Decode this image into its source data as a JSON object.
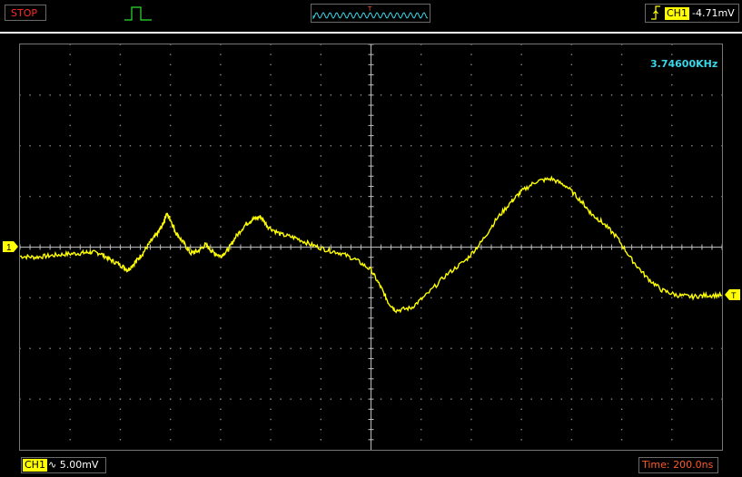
{
  "status": {
    "run_state": "STOP"
  },
  "trigger": {
    "channel": "CH1",
    "level": "-4.71mV",
    "marker": "T"
  },
  "measure": {
    "frequency": "3.74600KHz"
  },
  "channel": {
    "label": "CH1",
    "marker": "1",
    "coupling_symbol": "∿",
    "scale": "5.00mV"
  },
  "timebase": {
    "label": "Time: 200.0ns"
  },
  "colors": {
    "trace": "#ffff00",
    "grid": "#8a8a8a",
    "stop": "#ff2a2a",
    "freq": "#38d6e8",
    "time": "#ff5a2a"
  },
  "trace": {
    "note_units": "divisions; x 0..14 (left to right), y positive up, 0 = CH1 reference line",
    "points": [
      [
        0,
        -0.18
      ],
      [
        0.3,
        -0.2
      ],
      [
        0.6,
        -0.17
      ],
      [
        0.9,
        -0.14
      ],
      [
        1.2,
        -0.12
      ],
      [
        1.4,
        -0.1
      ],
      [
        1.6,
        -0.12
      ],
      [
        1.8,
        -0.25
      ],
      [
        2.0,
        -0.35
      ],
      [
        2.15,
        -0.45
      ],
      [
        2.3,
        -0.3
      ],
      [
        2.45,
        -0.12
      ],
      [
        2.6,
        0.1
      ],
      [
        2.75,
        0.28
      ],
      [
        2.85,
        0.45
      ],
      [
        2.92,
        0.66
      ],
      [
        3.0,
        0.55
      ],
      [
        3.1,
        0.3
      ],
      [
        3.25,
        0.1
      ],
      [
        3.4,
        -0.12
      ],
      [
        3.55,
        -0.08
      ],
      [
        3.7,
        0.05
      ],
      [
        3.85,
        -0.1
      ],
      [
        4.0,
        -0.18
      ],
      [
        4.15,
        -0.05
      ],
      [
        4.3,
        0.2
      ],
      [
        4.5,
        0.45
      ],
      [
        4.65,
        0.55
      ],
      [
        4.8,
        0.6
      ],
      [
        4.95,
        0.4
      ],
      [
        5.2,
        0.25
      ],
      [
        5.5,
        0.18
      ],
      [
        5.8,
        0.05
      ],
      [
        6.1,
        -0.05
      ],
      [
        6.4,
        -0.12
      ],
      [
        6.7,
        -0.25
      ],
      [
        7.0,
        -0.45
      ],
      [
        7.2,
        -0.8
      ],
      [
        7.35,
        -1.1
      ],
      [
        7.5,
        -1.25
      ],
      [
        7.8,
        -1.2
      ],
      [
        8.1,
        -0.95
      ],
      [
        8.5,
        -0.55
      ],
      [
        8.9,
        -0.25
      ],
      [
        9.2,
        0.1
      ],
      [
        9.5,
        0.55
      ],
      [
        9.8,
        0.9
      ],
      [
        10.0,
        1.1
      ],
      [
        10.3,
        1.3
      ],
      [
        10.6,
        1.35
      ],
      [
        10.9,
        1.2
      ],
      [
        11.2,
        0.9
      ],
      [
        11.4,
        0.65
      ],
      [
        11.6,
        0.5
      ],
      [
        11.9,
        0.2
      ],
      [
        12.2,
        -0.25
      ],
      [
        12.5,
        -0.6
      ],
      [
        12.8,
        -0.85
      ],
      [
        13.1,
        -0.95
      ],
      [
        13.4,
        -0.98
      ],
      [
        13.7,
        -0.95
      ],
      [
        14.0,
        -0.95
      ]
    ]
  }
}
